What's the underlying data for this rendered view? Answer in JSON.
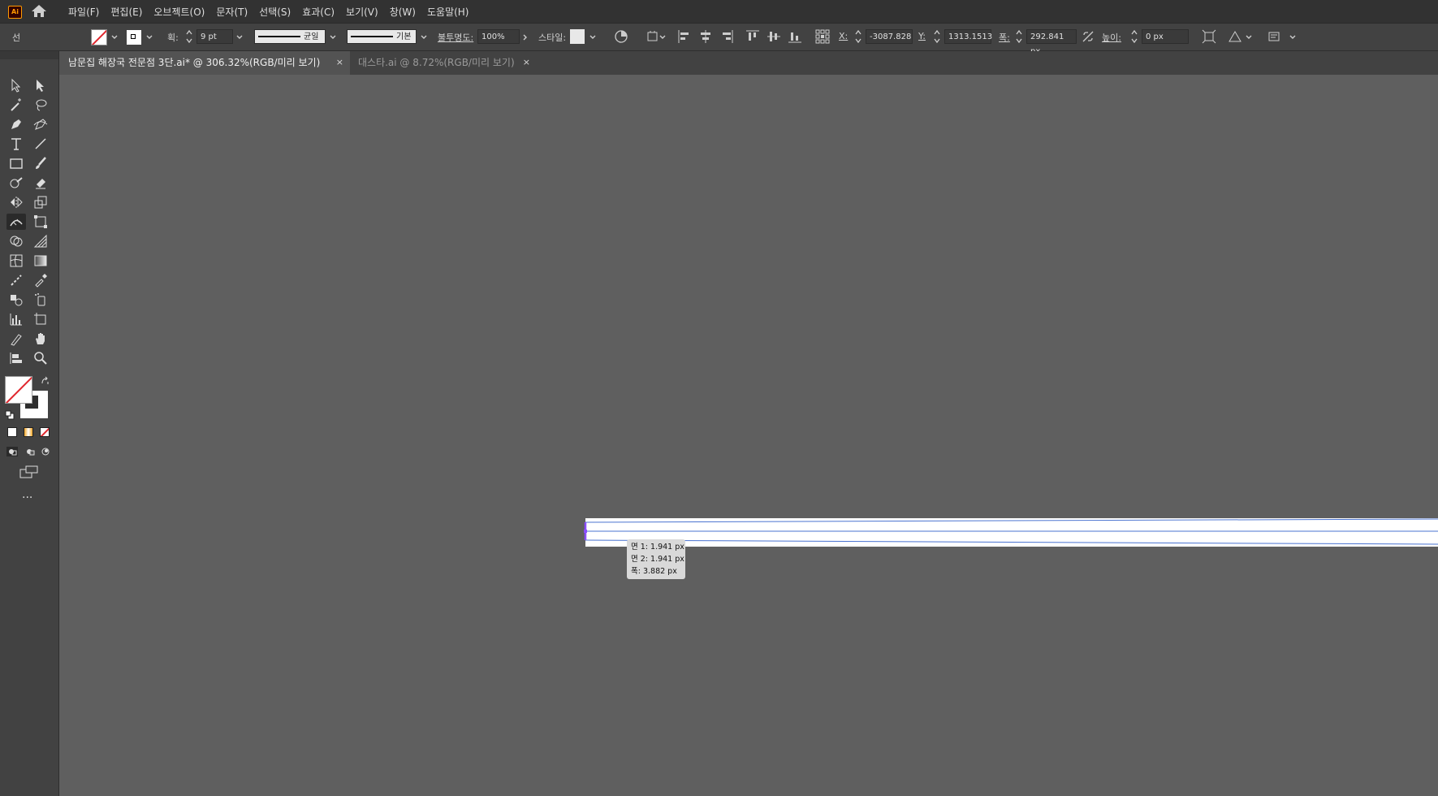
{
  "app": {
    "logo_text": "Ai"
  },
  "menu": [
    "파일(F)",
    "편집(E)",
    "오브젝트(O)",
    "문자(T)",
    "선택(S)",
    "효과(C)",
    "보기(V)",
    "창(W)",
    "도움말(H)"
  ],
  "control": {
    "selection_type": "선",
    "stroke_label": "획:",
    "stroke_weight": "9 pt",
    "profile_label": "균일",
    "brush_label": "기본",
    "opacity_label": "불투명도:",
    "opacity_value": "100%",
    "style_label": "스타일:",
    "x_label": "X:",
    "x_value": "-3087.8286",
    "y_label": "Y:",
    "y_value": "1313.1513",
    "width_label": "폭:",
    "width_value": "292.841 px",
    "height_label": "높이:",
    "height_value": "0 px"
  },
  "tabs": [
    {
      "label": "남문집 해장국 전문점 3단.ai* @ 306.32%(RGB/미리 보기)",
      "active": true,
      "close": "×"
    },
    {
      "label": "대스타.ai @ 8.72%(RGB/미리 보기)",
      "active": false,
      "close": "×"
    }
  ],
  "tooltip": {
    "line1": "면 1: 1.941 px",
    "line2": "면 2: 1.941 px",
    "line3": "폭:  3.882 px"
  },
  "tools": [
    "selection-tool",
    "direct-selection-tool",
    "magic-wand-tool",
    "lasso-tool",
    "pen-tool",
    "curvature-tool",
    "type-tool",
    "line-segment-tool",
    "rectangle-tool",
    "paintbrush-tool",
    "shaper-tool",
    "eraser-tool",
    "reflect-tool",
    "scale-tool",
    "width-tool",
    "free-transform-tool",
    "shape-builder-tool",
    "perspective-grid-tool",
    "mesh-tool",
    "gradient-tool",
    "eyedropper-tool",
    "measure-tool",
    "blend-tool",
    "symbol-sprayer-tool",
    "column-graph-tool",
    "artboard-tool",
    "slice-tool",
    "hand-tool",
    "print-tiling-tool",
    "zoom-tool"
  ],
  "more_tools": "...",
  "colors": {
    "chrome": "#424242",
    "menubar": "#323232",
    "canvas": "#5f5f5f",
    "path": "#4a73d0",
    "accent": "#ff9a00"
  }
}
